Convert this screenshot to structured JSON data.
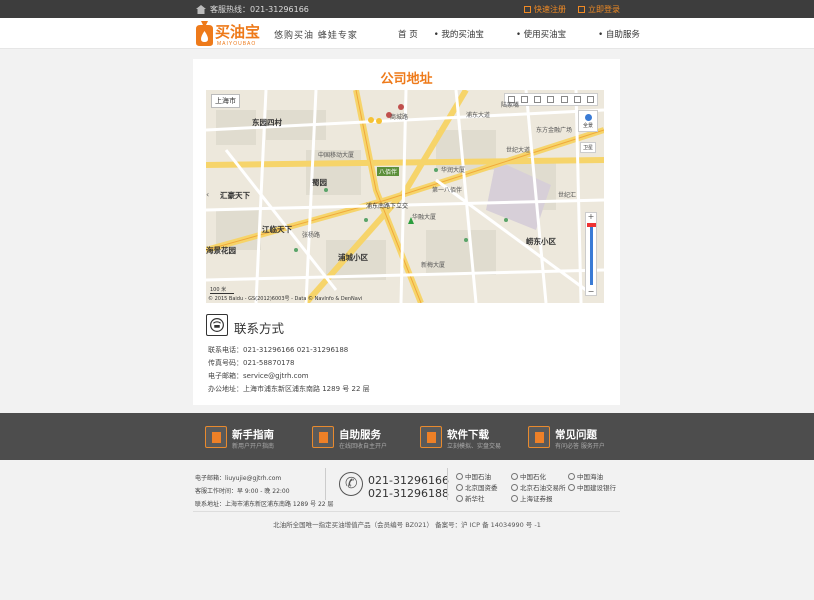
{
  "topbar": {
    "hotline": "客服热线：021-31296166",
    "quick_register": "快速注册",
    "login": "立即登录"
  },
  "header": {
    "logo_text": "买油宝",
    "logo_sub": "MAIYOUBAO",
    "slogan": "悠购买油  蜂娃专家",
    "nav": [
      "首 页",
      "我的买油宝",
      "使用买油宝",
      "自助服务"
    ]
  },
  "main": {
    "title": "公司地址",
    "map": {
      "city": "上海市",
      "copyright": "© 2015 Baidu - GS(2012)6003号 - Data © NavInfo & DenNavi",
      "scale": "100 米",
      "nav_label": "全景",
      "satellite_label": "卫星",
      "labels_big": [
        "东园四村",
        "汇豪天下",
        "江临天下",
        "蜀园",
        "浦城小区",
        "崂东小区",
        "海景花园"
      ],
      "labels_small": [
        "浦东南路下立交",
        "华融大厦",
        "八佰伴",
        "商城路",
        "中国移动大厦",
        "新梅大厦",
        "张杨路",
        "世纪大道",
        "东方金融广场",
        "华润大厦",
        "浦东大道",
        "陆家嘴",
        "第一八佰伴",
        "世纪汇"
      ]
    },
    "contact": {
      "title": "联系方式",
      "phone": "联系电话：021-31296166  021-31296188",
      "fax": "传真号码：021-58870178",
      "email": "电子邮箱：service@gjtrh.com",
      "address": "办公地址：上海市浦东新区浦东南路 1289 号 22 层"
    }
  },
  "services": [
    {
      "title": "新手指南",
      "sub": "新用户开户指南"
    },
    {
      "title": "自助服务",
      "sub": "在线回收自主开户"
    },
    {
      "title": "软件下载",
      "sub": "立刻模拟、实盘交易"
    },
    {
      "title": "常见问题",
      "sub": "有问必答  服务开户"
    }
  ],
  "footer": {
    "email": "电子邮箱：liuyujie@gjtrh.com",
    "hours": "客服工作时间：早 9:00 - 晚 22:00",
    "address": "联系地址：上海市浦东新区浦东南路 1289 号 22 层",
    "phone1": "021-31296166",
    "phone2": "021-31296188",
    "partners": [
      "中国石油",
      "中国石化",
      "中国海油",
      "北京国资委",
      "北京石油交易所",
      "中国建设银行",
      "新华社",
      "上海证券报"
    ],
    "icp": "北油所全国唯一指定买油增值产品（会员编号 BZ021）   备案号：沪 ICP 备 14034990 号 -1"
  },
  "colors": {
    "accent": "#ee7a1a",
    "topbar": "#3d3d3d",
    "services_bg": "#4d4d4d"
  }
}
